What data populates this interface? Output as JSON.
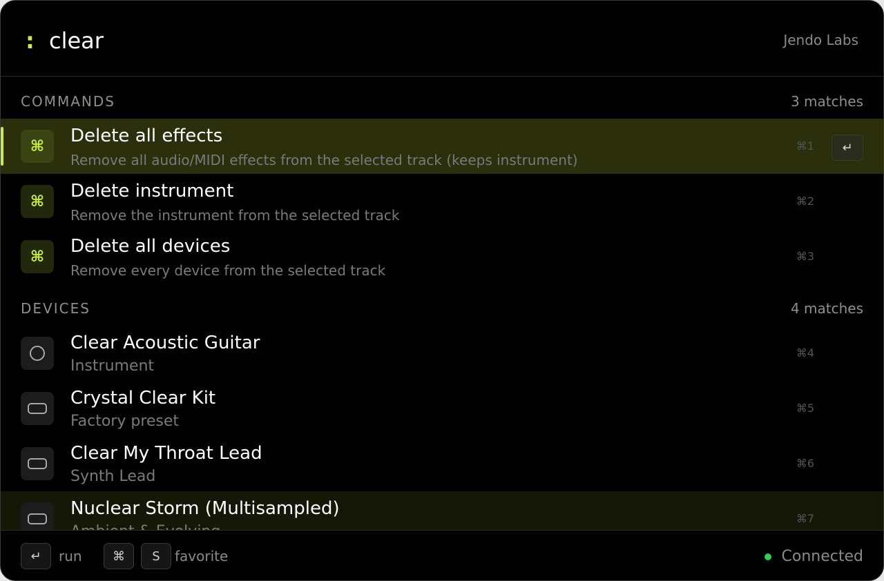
{
  "search": {
    "prompt": ":",
    "value": "clear"
  },
  "brand": "Jendo Labs",
  "sections": {
    "commands": {
      "title": "COMMANDS",
      "count": "3 matches",
      "items": [
        {
          "title": "Delete all effects",
          "subtitle": "Remove all audio/MIDI effects from the selected track (keeps instrument)",
          "shortcut": "⌘1",
          "icon": "command-icon"
        },
        {
          "title": "Delete instrument",
          "subtitle": "Remove the instrument from the selected track",
          "shortcut": "⌘2",
          "icon": "command-icon"
        },
        {
          "title": "Delete all devices",
          "subtitle": "Remove every device from the selected track",
          "shortcut": "⌘3",
          "icon": "command-icon"
        }
      ]
    },
    "devices": {
      "title": "DEVICES",
      "count": "4 matches",
      "items": [
        {
          "title": "Clear Acoustic Guitar",
          "subtitle": "Instrument",
          "shortcut": "⌘4",
          "icon": "instrument-icon"
        },
        {
          "title": "Crystal Clear Kit",
          "subtitle": "Factory preset",
          "shortcut": "⌘5",
          "icon": "preset-icon"
        },
        {
          "title": "Clear My Throat Lead",
          "subtitle": "Synth Lead",
          "shortcut": "⌘6",
          "icon": "preset-icon"
        },
        {
          "title": "Nuclear Storm (Multisampled)",
          "subtitle": "Ambient & Evolving",
          "shortcut": "⌘7",
          "icon": "preset-icon"
        }
      ]
    }
  },
  "cmd_glyph": "⌘",
  "enter_glyph": "↵",
  "footer": {
    "run_key": "↵",
    "run_label": "run",
    "fav_key1": "⌘",
    "fav_key2": "S",
    "fav_label": "favorite",
    "status": "Connected"
  },
  "colors": {
    "accent": "#c8f03c",
    "status_ok": "#2ecc5a",
    "selected_row": "#2b2f0c"
  }
}
